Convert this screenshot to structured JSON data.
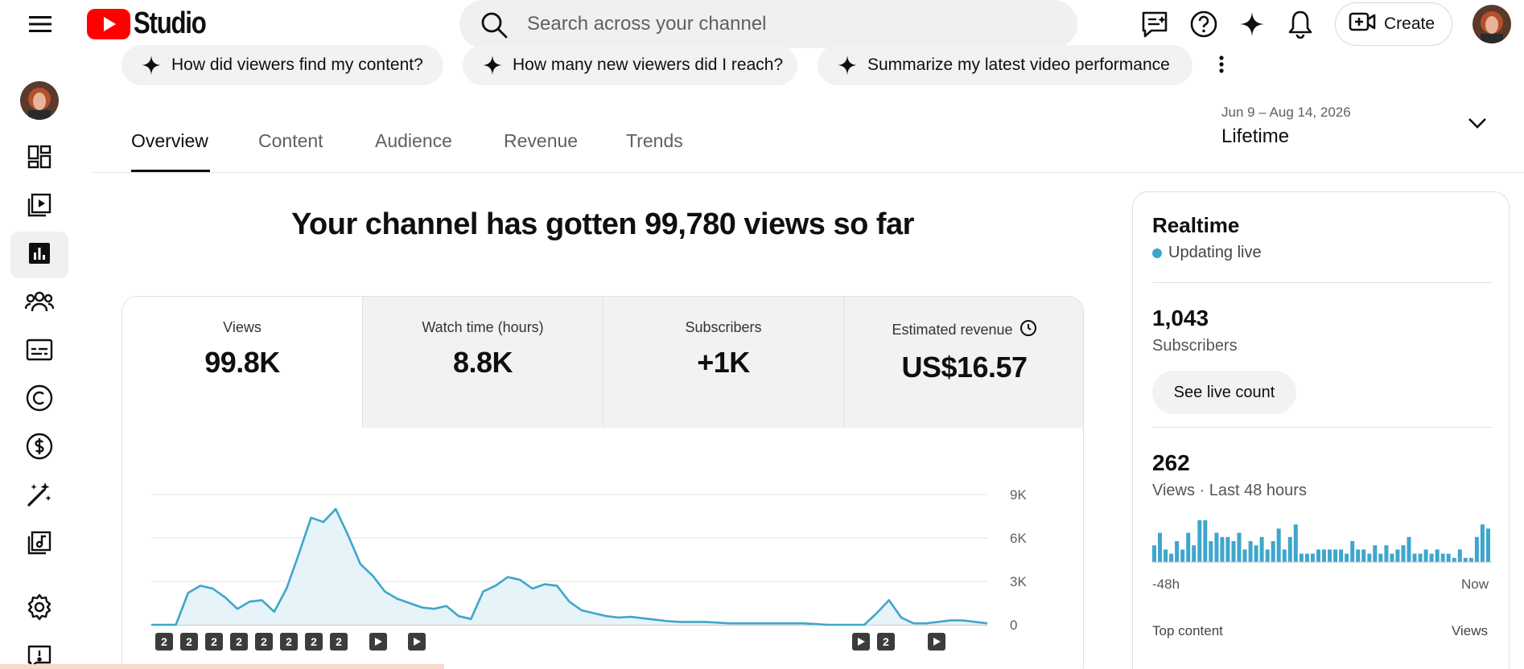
{
  "header": {
    "logo_text": "Studio",
    "search_placeholder": "Search across your channel",
    "create_label": "Create",
    "icons": [
      "menu-icon",
      "feedback-icon",
      "help-icon",
      "sparkle-icon",
      "bell-icon",
      "create-video-icon"
    ]
  },
  "sidebar": {
    "items": [
      {
        "name": "dashboard",
        "icon": "dashboard-icon"
      },
      {
        "name": "content",
        "icon": "video-library-icon"
      },
      {
        "name": "analytics",
        "icon": "analytics-icon",
        "active": true
      },
      {
        "name": "community",
        "icon": "community-icon"
      },
      {
        "name": "subtitles",
        "icon": "subtitles-icon"
      },
      {
        "name": "copyright",
        "icon": "copyright-icon"
      },
      {
        "name": "earn",
        "icon": "earn-icon"
      },
      {
        "name": "customization",
        "icon": "magic-wand-icon"
      },
      {
        "name": "audio-library",
        "icon": "audio-library-icon"
      },
      {
        "name": "settings",
        "icon": "gear-icon"
      },
      {
        "name": "feedback",
        "icon": "feedback-alert-icon"
      }
    ]
  },
  "chips": [
    "How did viewers find my content?",
    "How many new viewers did I reach?",
    "Summarize my latest video performance"
  ],
  "tabs": [
    "Overview",
    "Content",
    "Audience",
    "Revenue",
    "Trends"
  ],
  "active_tab": "Overview",
  "date": {
    "range": "Jun 9 – Aug 14, 2026",
    "label": "Lifetime"
  },
  "headline": "Your channel has gotten 99,780 views so far",
  "metrics": [
    {
      "label": "Views",
      "value": "99.8K"
    },
    {
      "label": "Watch time (hours)",
      "value": "8.8K"
    },
    {
      "label": "Subscribers",
      "value": "+1K"
    },
    {
      "label": "Estimated revenue",
      "value": "US$16.57"
    }
  ],
  "chart_data": {
    "type": "area",
    "yticks": [
      "9K",
      "6K",
      "3K",
      "0"
    ],
    "ylim": [
      0,
      9000
    ],
    "color": "#3ea6cc",
    "values": [
      0,
      0,
      0,
      2200,
      2700,
      2500,
      1900,
      1100,
      1600,
      1700,
      900,
      2500,
      4900,
      7400,
      7100,
      8000,
      6200,
      4200,
      3400,
      2300,
      1800,
      1500,
      1200,
      1100,
      1300,
      600,
      400,
      2300,
      2700,
      3300,
      3100,
      2500,
      2800,
      2700,
      1600,
      1000,
      800,
      600,
      500,
      550,
      450,
      350,
      250,
      200,
      200,
      200,
      150,
      100,
      100,
      100,
      100,
      100,
      100,
      100,
      50,
      0,
      0,
      0,
      0,
      800,
      1700,
      500,
      100,
      100,
      200,
      300,
      300,
      200,
      100
    ],
    "markers": [
      "2",
      "2",
      "2",
      "2",
      "2",
      "2",
      "2",
      "2",
      "play",
      "play",
      "play",
      "2",
      "play"
    ]
  },
  "realtime": {
    "title": "Realtime",
    "status": "Updating live",
    "subscribers_value": "1,043",
    "subscribers_label": "Subscribers",
    "live_button": "See live count",
    "views_value": "262",
    "views_label": "Views · Last 48 hours",
    "axis_start": "-48h",
    "axis_end": "Now",
    "top_content_label": "Top content",
    "top_content_col": "Views",
    "bars": [
      4,
      7,
      3,
      2,
      5,
      3,
      7,
      4,
      10,
      10,
      5,
      7,
      6,
      6,
      5,
      7,
      3,
      5,
      4,
      6,
      3,
      5,
      8,
      3,
      6,
      9,
      2,
      2,
      2,
      3,
      3,
      3,
      3,
      3,
      2,
      5,
      3,
      3,
      2,
      4,
      2,
      4,
      2,
      3,
      4,
      6,
      2,
      2,
      3,
      2,
      3,
      2,
      2,
      1,
      3,
      1,
      1,
      6,
      9,
      8
    ]
  }
}
